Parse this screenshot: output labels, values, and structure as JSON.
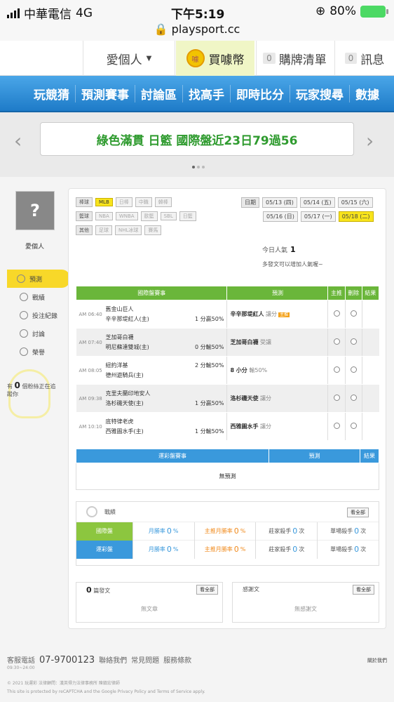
{
  "status": {
    "carrier": "中華電信",
    "net": "4G",
    "time": "下午5:19",
    "battery": "80%",
    "url": "playsport.cc"
  },
  "topnav": {
    "user": "愛個人",
    "buy": "買噱幣",
    "coin_mark": "噱",
    "cart_count": "0",
    "cart": "購牌清單",
    "msg_count": "0",
    "msg": "訊息"
  },
  "menu": [
    "玩競猜",
    "預測賽事",
    "討論區",
    "找高手",
    "即時比分",
    "玩家搜尋",
    "數據"
  ],
  "banner": {
    "prev": "‹",
    "next": "›",
    "text": "綠色滿貫 日籃 國際盤近23日79過56"
  },
  "sidebar": {
    "name": "愛個人",
    "items": [
      {
        "label": "預測",
        "active": true
      },
      {
        "label": "戰績"
      },
      {
        "label": "投注紀錄"
      },
      {
        "label": "討論"
      },
      {
        "label": "榮譽"
      }
    ],
    "tip_pre": "有",
    "tip_count": "0",
    "tip_post": "個粉絲正在追蹤你"
  },
  "filters": {
    "baseball_label": "棒球",
    "baseball": [
      "MLB",
      "日棒",
      "中職",
      "韓棒"
    ],
    "basketball_label": "籃球",
    "basketball": [
      "NBA",
      "WNBA",
      "歐籃",
      "SBL",
      "日籃"
    ],
    "other_label": "其他",
    "other": [
      "足球",
      "NHL冰球",
      "賽馬"
    ],
    "date_label": "日期",
    "dates": [
      "05/13 (四)",
      "05/14 (五)",
      "05/15 (六)",
      "05/16 (日)",
      "05/17 (一)",
      "05/18 (二)"
    ]
  },
  "popularity": {
    "label": "今日人氣",
    "value": "1",
    "hint": "多發文可以增加人氣喔~"
  },
  "intl_table": {
    "headers": [
      "國際盤賽事",
      "預測",
      "主推",
      "刪除",
      "結果"
    ],
    "rows": [
      {
        "time": "AM 06:40",
        "away": "舊金山巨人",
        "home": "辛辛那堤紅人(主)",
        "line": "1 分贏50%",
        "pick": "辛辛那堤紅人",
        "note": "讓分",
        "hot": "主推"
      },
      {
        "time": "AM 07:40",
        "away": "芝加哥白襪",
        "home": "明尼蘇達雙城(主)",
        "line": "0 分輸50%",
        "pick": "芝加哥白襪",
        "note": "受讓"
      },
      {
        "time": "AM 08:05",
        "away": "紐約洋基",
        "home": "德州遊騎兵(主)",
        "line": "2 分輸50%",
        "pick": "8 小分",
        "note": "輸50%"
      },
      {
        "time": "AM 09:38",
        "away": "克里夫蘭印地安人",
        "home": "洛杉磯天使(主)",
        "line": "1 分贏50%",
        "pick": "洛杉磯天使",
        "note": "讓分"
      },
      {
        "time": "AM 10:10",
        "away": "底特律老虎",
        "home": "西雅圖水手(主)",
        "line": "1 分輸50%",
        "pick": "西雅圖水手",
        "note": "讓分"
      }
    ]
  },
  "lottery_table": {
    "headers": [
      "運彩盤賽事",
      "預測",
      "結果"
    ],
    "empty": "無預測"
  },
  "record": {
    "title": "戰績",
    "all": "看全部",
    "rows": [
      {
        "label": "國際盤",
        "color": "#8cc63f",
        "month": "月勝率",
        "m": "0",
        "main": "主推月勝率",
        "mm": "0",
        "kill": "莊家殺手",
        "k": "0",
        "k_unit": "次",
        "single": "單場殺手",
        "s": "0",
        "s_unit": "次",
        "pct": "%"
      },
      {
        "label": "運彩盤",
        "color": "#3a99dc",
        "month": "月勝率",
        "m": "0",
        "main": "主推月勝率",
        "mm": "0",
        "kill": "莊家殺手",
        "k": "0",
        "k_unit": "次",
        "single": "單場殺手",
        "s": "0",
        "s_unit": "次",
        "pct": "%"
      }
    ]
  },
  "posts": {
    "count": "0",
    "label": "篇發文",
    "all": "看全部",
    "empty": "無文章"
  },
  "thanks": {
    "label": "感謝文",
    "all": "看全部",
    "empty": "無感謝文"
  },
  "footer": {
    "service": "客服電話",
    "phone": "07-9700123",
    "hours": "09:30~24:00",
    "links": [
      "聯絡我們",
      "常見問題",
      "服務條款"
    ],
    "about": "關於我們",
    "copyright": "© 2021 玩運彩 法律顧問：漢英得力法律事務所 陳鎮宏律師",
    "recaptcha": "This site is protected by reCAPTCHA and the Google Privacy Policy and Terms of Service apply."
  }
}
